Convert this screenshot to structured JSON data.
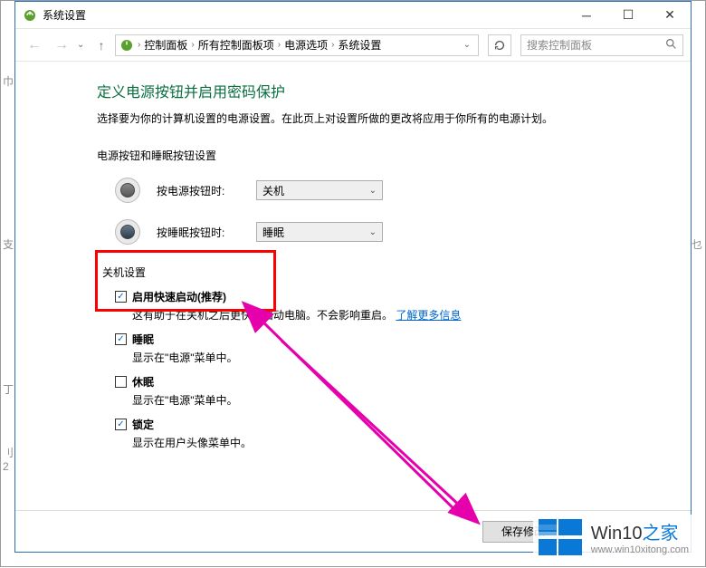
{
  "window": {
    "title": "系统设置"
  },
  "nav": {
    "breadcrumb": [
      "控制面板",
      "所有控制面板项",
      "电源选项",
      "系统设置"
    ],
    "search_placeholder": "搜索控制面板"
  },
  "page": {
    "heading": "定义电源按钮并启用密码保护",
    "subtext": "选择要为你的计算机设置的电源设置。在此页上对设置所做的更改将应用于你所有的电源计划。",
    "button_section_label": "电源按钮和睡眠按钮设置",
    "power_button": {
      "label": "按电源按钮时:",
      "value": "关机"
    },
    "sleep_button": {
      "label": "按睡眠按钮时:",
      "value": "睡眠"
    },
    "shutdown_section_label": "关机设置",
    "options": {
      "fast_start": {
        "label": "启用快速启动(推荐)",
        "desc_a": "这有助于在关机之后更快地启动电脑。不会影响重启。",
        "desc_link": "了解更多信息",
        "checked": true
      },
      "sleep": {
        "label": "睡眠",
        "desc": "显示在\"电源\"菜单中。",
        "checked": true
      },
      "hibernate": {
        "label": "休眠",
        "desc": "显示在\"电源\"菜单中。",
        "checked": false
      },
      "lock": {
        "label": "锁定",
        "desc": "显示在用户头像菜单中。",
        "checked": true
      }
    },
    "save_button": "保存修改"
  },
  "watermark": {
    "brand": "Win10",
    "suffix": "之家",
    "url": "www.win10xitong.com"
  }
}
